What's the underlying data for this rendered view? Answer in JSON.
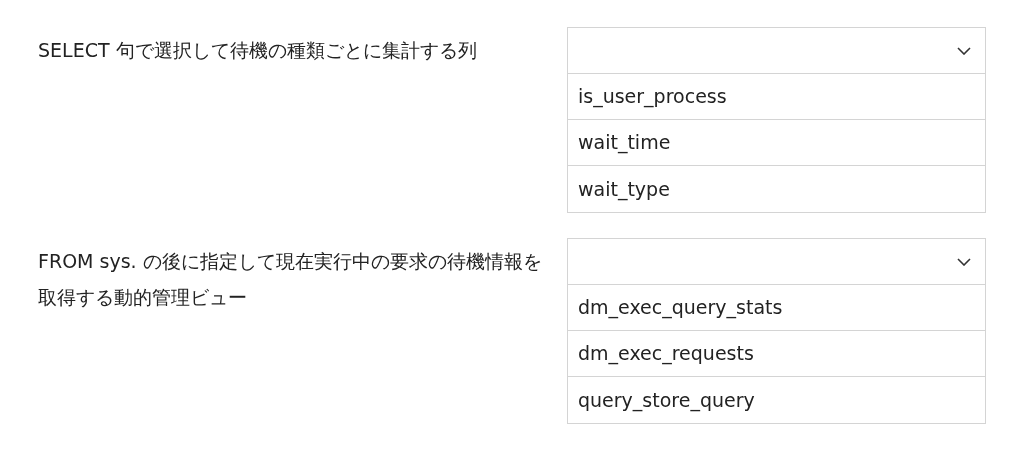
{
  "questions": [
    {
      "prompt": "SELECT 句で選択して待機の種類ごとに集計する列",
      "options": [
        {
          "label": "is_user_process",
          "selected": false
        },
        {
          "label": "wait_time",
          "selected": false
        },
        {
          "label": "wait_type",
          "selected": false
        }
      ]
    },
    {
      "prompt": "FROM sys. の後に指定して現在実行中の要求の待機情報を取得する動的管理ビュー",
      "options": [
        {
          "label": "dm_exec_query_stats",
          "selected": false
        },
        {
          "label": "dm_exec_requests",
          "selected": false
        },
        {
          "label": "query_store_query",
          "selected": false
        }
      ]
    }
  ]
}
